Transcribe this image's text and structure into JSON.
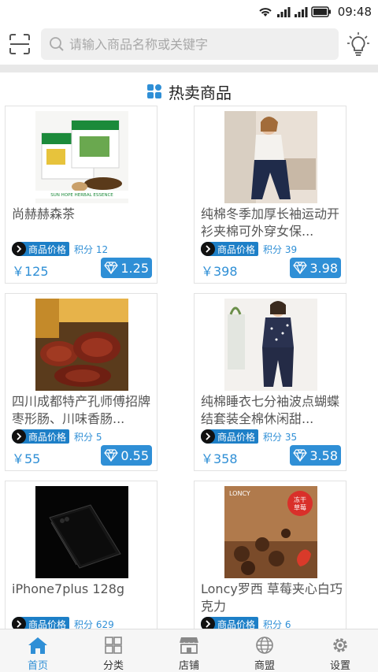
{
  "status_bar": {
    "time": "09:48",
    "icons": [
      "wifi-icon",
      "signal-icon",
      "signal-icon",
      "battery-icon"
    ]
  },
  "header": {
    "search_placeholder": "请输入商品名称或关键字",
    "left_icon": "scan-icon",
    "right_icon": "lightbulb-icon"
  },
  "section": {
    "title": "热卖商品",
    "icon": "grid-icon"
  },
  "products": [
    {
      "name": "尚赫赫森茶",
      "tag": "商品价格",
      "points": "积分 12",
      "price": "￥125",
      "diamond": "1.25"
    },
    {
      "name": "纯棉冬季加厚长袖运动开衫夹棉可外穿女保...",
      "tag": "商品价格",
      "points": "积分 39",
      "price": "￥398",
      "diamond": "3.98"
    },
    {
      "name": "四川成都特产孔师傅招牌枣形肠、川味香肠...",
      "tag": "商品价格",
      "points": "积分 5",
      "price": "￥55",
      "diamond": "0.55"
    },
    {
      "name": "纯棉睡衣七分袖波点蝴蝶结套装全棉休闲甜...",
      "tag": "商品价格",
      "points": "积分 35",
      "price": "￥358",
      "diamond": "3.58"
    },
    {
      "name": "iPhone7plus 128g",
      "tag": "商品价格",
      "points": "积分 629",
      "price": "",
      "diamond": ""
    },
    {
      "name": "Loncy罗西 草莓夹心白巧克力",
      "tag": "商品价格",
      "points": "积分 6",
      "price": "",
      "diamond": ""
    }
  ],
  "product_image_texts": {
    "tea_box": "SUN HOPE HERBAL ESSENCE",
    "chocolate_brand": "LONCY",
    "chocolate_badge_1": "冻干",
    "chocolate_badge_2": "草莓"
  },
  "tabbar": [
    {
      "label": "首页",
      "icon": "home-icon",
      "active": true
    },
    {
      "label": "分类",
      "icon": "category-icon",
      "active": false
    },
    {
      "label": "店铺",
      "icon": "store-icon",
      "active": false
    },
    {
      "label": "商盟",
      "icon": "globe-icon",
      "active": false
    },
    {
      "label": "设置",
      "icon": "settings-icon",
      "active": false
    }
  ],
  "colors": {
    "accent": "#2f8fd6",
    "tag_blue": "#1d7fc7",
    "background": "#eeeeee"
  }
}
